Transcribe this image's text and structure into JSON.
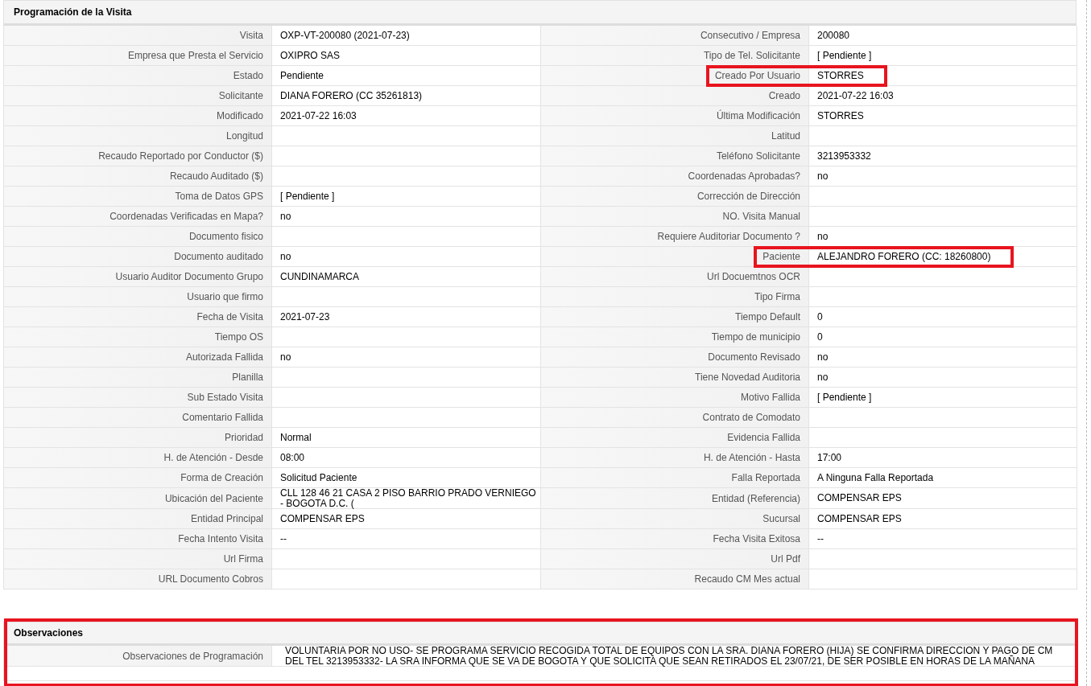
{
  "visit_panel": {
    "title": "Programación de la Visita",
    "rows": [
      [
        {
          "label": "Visita",
          "value": "OXP-VT-200080 (2021-07-23)",
          "highlighted": false
        },
        {
          "label": "Consecutivo / Empresa",
          "value": "200080",
          "highlighted": false
        }
      ],
      [
        {
          "label": "Empresa que Presta el Servicio",
          "value": "OXIPRO SAS",
          "highlighted": false
        },
        {
          "label": "Tipo de Tel. Solicitante",
          "value": "[ Pendiente ]",
          "highlighted": false
        }
      ],
      [
        {
          "label": "Estado",
          "value": "Pendiente",
          "highlighted": false
        },
        {
          "label": "Creado Por Usuario",
          "value": "STORRES",
          "highlighted": true
        }
      ],
      [
        {
          "label": "Solicitante",
          "value": "DIANA FORERO (CC 35261813)",
          "highlighted": false
        },
        {
          "label": "Creado",
          "value": "2021-07-22 16:03",
          "highlighted": false
        }
      ],
      [
        {
          "label": "Modificado",
          "value": "2021-07-22 16:03",
          "highlighted": false
        },
        {
          "label": "Última Modificación",
          "value": "STORRES",
          "highlighted": false
        }
      ],
      [
        {
          "label": "Longitud",
          "highlighted": false
        },
        {
          "label": "Latitud",
          "highlighted": false
        }
      ],
      [
        {
          "label": "Recaudo Reportado por Conductor ($)",
          "highlighted": false
        },
        {
          "label": "Teléfono Solicitante",
          "value": "3213953332",
          "highlighted": false
        }
      ],
      [
        {
          "label": "Recaudo Auditado ($)",
          "highlighted": false
        },
        {
          "label": "Coordenadas Aprobadas?",
          "value": "no",
          "highlighted": false
        }
      ],
      [
        {
          "label": "Toma de Datos GPS",
          "value": "[ Pendiente ]",
          "highlighted": false
        },
        {
          "label": "Corrección de Dirección",
          "highlighted": false
        }
      ],
      [
        {
          "label": "Coordenadas Verificadas en Mapa?",
          "value": "no",
          "highlighted": false
        },
        {
          "label": "NO. Visita Manual",
          "highlighted": false
        }
      ],
      [
        {
          "label": "Documento fisico",
          "highlighted": false
        },
        {
          "label": "Requiere Auditoriar Documento ?",
          "value": "no",
          "highlighted": false
        }
      ],
      [
        {
          "label": "Documento auditado",
          "value": "no",
          "highlighted": false
        },
        {
          "label": "Paciente",
          "value": "ALEJANDRO FORERO (CC: 18260800)",
          "highlighted": true
        }
      ],
      [
        {
          "label": "Usuario Auditor Documento Grupo",
          "value": "CUNDINAMARCA",
          "highlighted": false
        },
        {
          "label": "Url Docuemtnos OCR",
          "highlighted": false
        }
      ],
      [
        {
          "label": "Usuario que firmo",
          "highlighted": false
        },
        {
          "label": "Tipo Firma",
          "highlighted": false
        }
      ],
      [
        {
          "label": "Fecha de Visita",
          "value": "2021-07-23",
          "highlighted": false
        },
        {
          "label": "Tiempo Default",
          "value": "0",
          "highlighted": false
        }
      ],
      [
        {
          "label": "Tiempo OS",
          "highlighted": false
        },
        {
          "label": "Tiempo de municipio",
          "value": "0",
          "highlighted": false
        }
      ],
      [
        {
          "label": "Autorizada Fallida",
          "value": "no",
          "highlighted": false
        },
        {
          "label": "Documento Revisado",
          "value": "no",
          "highlighted": false
        }
      ],
      [
        {
          "label": "Planilla",
          "highlighted": false
        },
        {
          "label": "Tiene Novedad Auditoria",
          "value": "no",
          "highlighted": false
        }
      ],
      [
        {
          "label": "Sub Estado Visita",
          "highlighted": false
        },
        {
          "label": "Motivo Fallida",
          "value": "[ Pendiente ]",
          "highlighted": false
        }
      ],
      [
        {
          "label": "Comentario Fallida",
          "highlighted": false
        },
        {
          "label": "Contrato de Comodato",
          "highlighted": false
        }
      ],
      [
        {
          "label": "Prioridad",
          "value": "Normal",
          "highlighted": false
        },
        {
          "label": "Evidencia Fallida",
          "highlighted": false
        }
      ],
      [
        {
          "label": "H. de Atención - Desde",
          "value": "08:00",
          "highlighted": false
        },
        {
          "label": "H. de Atención - Hasta",
          "value": "17:00",
          "highlighted": false
        }
      ],
      [
        {
          "label": "Forma de Creación",
          "value": "Solicitud Paciente",
          "highlighted": false
        },
        {
          "label": "Falla Reportada",
          "value": "A Ninguna Falla Reportada",
          "highlighted": false
        }
      ],
      [
        {
          "label": "Ubicación del Paciente",
          "value": "CLL 128 46 21 CASA 2 PISO BARRIO PRADO VERNIEGO - BOGOTA D.C. (",
          "highlighted": false
        },
        {
          "label": "Entidad (Referencia)",
          "value": "COMPENSAR EPS",
          "highlighted": false
        }
      ],
      [
        {
          "label": "Entidad Principal",
          "value": "COMPENSAR EPS",
          "highlighted": false
        },
        {
          "label": "Sucursal",
          "value": "COMPENSAR EPS",
          "highlighted": false
        }
      ],
      [
        {
          "label": "Fecha Intento Visita",
          "value": "--",
          "highlighted": false
        },
        {
          "label": "Fecha Visita Exitosa",
          "value": "--",
          "highlighted": false
        }
      ],
      [
        {
          "label": "Url Firma",
          "highlighted": false
        },
        {
          "label": "Url Pdf",
          "highlighted": false
        }
      ],
      [
        {
          "label": "URL Documento Cobros",
          "highlighted": false
        },
        {
          "label": "Recaudo CM Mes actual",
          "highlighted": false
        }
      ]
    ]
  },
  "observations_panel": {
    "title": "Observaciones",
    "highlighted": true,
    "rows": [
      {
        "label": "Observaciones de Programación",
        "value": "VOLUNTARIA POR NO USO- SE PROGRAMA SERVICIO RECOGIDA TOTAL DE EQUIPOS CON LA SRA. DIANA FORERO (HIJA) SE CONFIRMA DIRECCION Y PAGO DE CM DEL TEL 3213953332- LA SRA INFORMA QUE SE VA DE BOGOTA Y QUE SOLICITA QUE SEAN RETIRADOS EL 23/07/21, DE SER POSIBLE EN HORAS DE LA MAÑANA"
      }
    ]
  }
}
